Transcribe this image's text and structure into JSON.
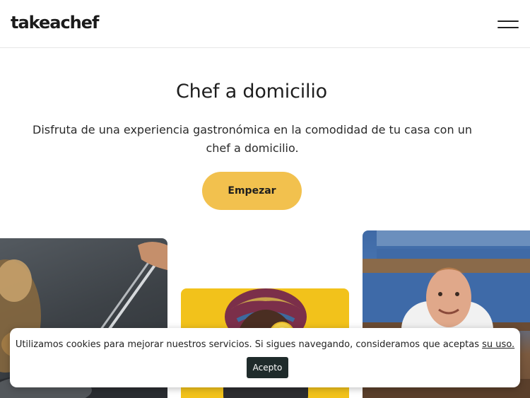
{
  "header": {
    "logo_text": "takeachef",
    "menu_icon": "hamburger-menu-icon"
  },
  "hero": {
    "title": "Chef a domicilio",
    "subtitle": "Disfruta de una experiencia gastronómica en la comodidad de tu casa con un chef a domicilio.",
    "cta_label": "Empezar"
  },
  "gallery": {
    "images": [
      "chef-plating-with-tweezers-photo",
      "chef-with-lemon-photo",
      "smiling-chef-photo"
    ]
  },
  "cookie_banner": {
    "text": "Utilizamos cookies para mejorar nuestros servicios. Si sigues navegando, consideramos que aceptas",
    "link_text": "su uso.",
    "accept_label": "Acepto"
  },
  "colors": {
    "accent": "#f2c14e",
    "dark_button": "#1f2b2b"
  }
}
